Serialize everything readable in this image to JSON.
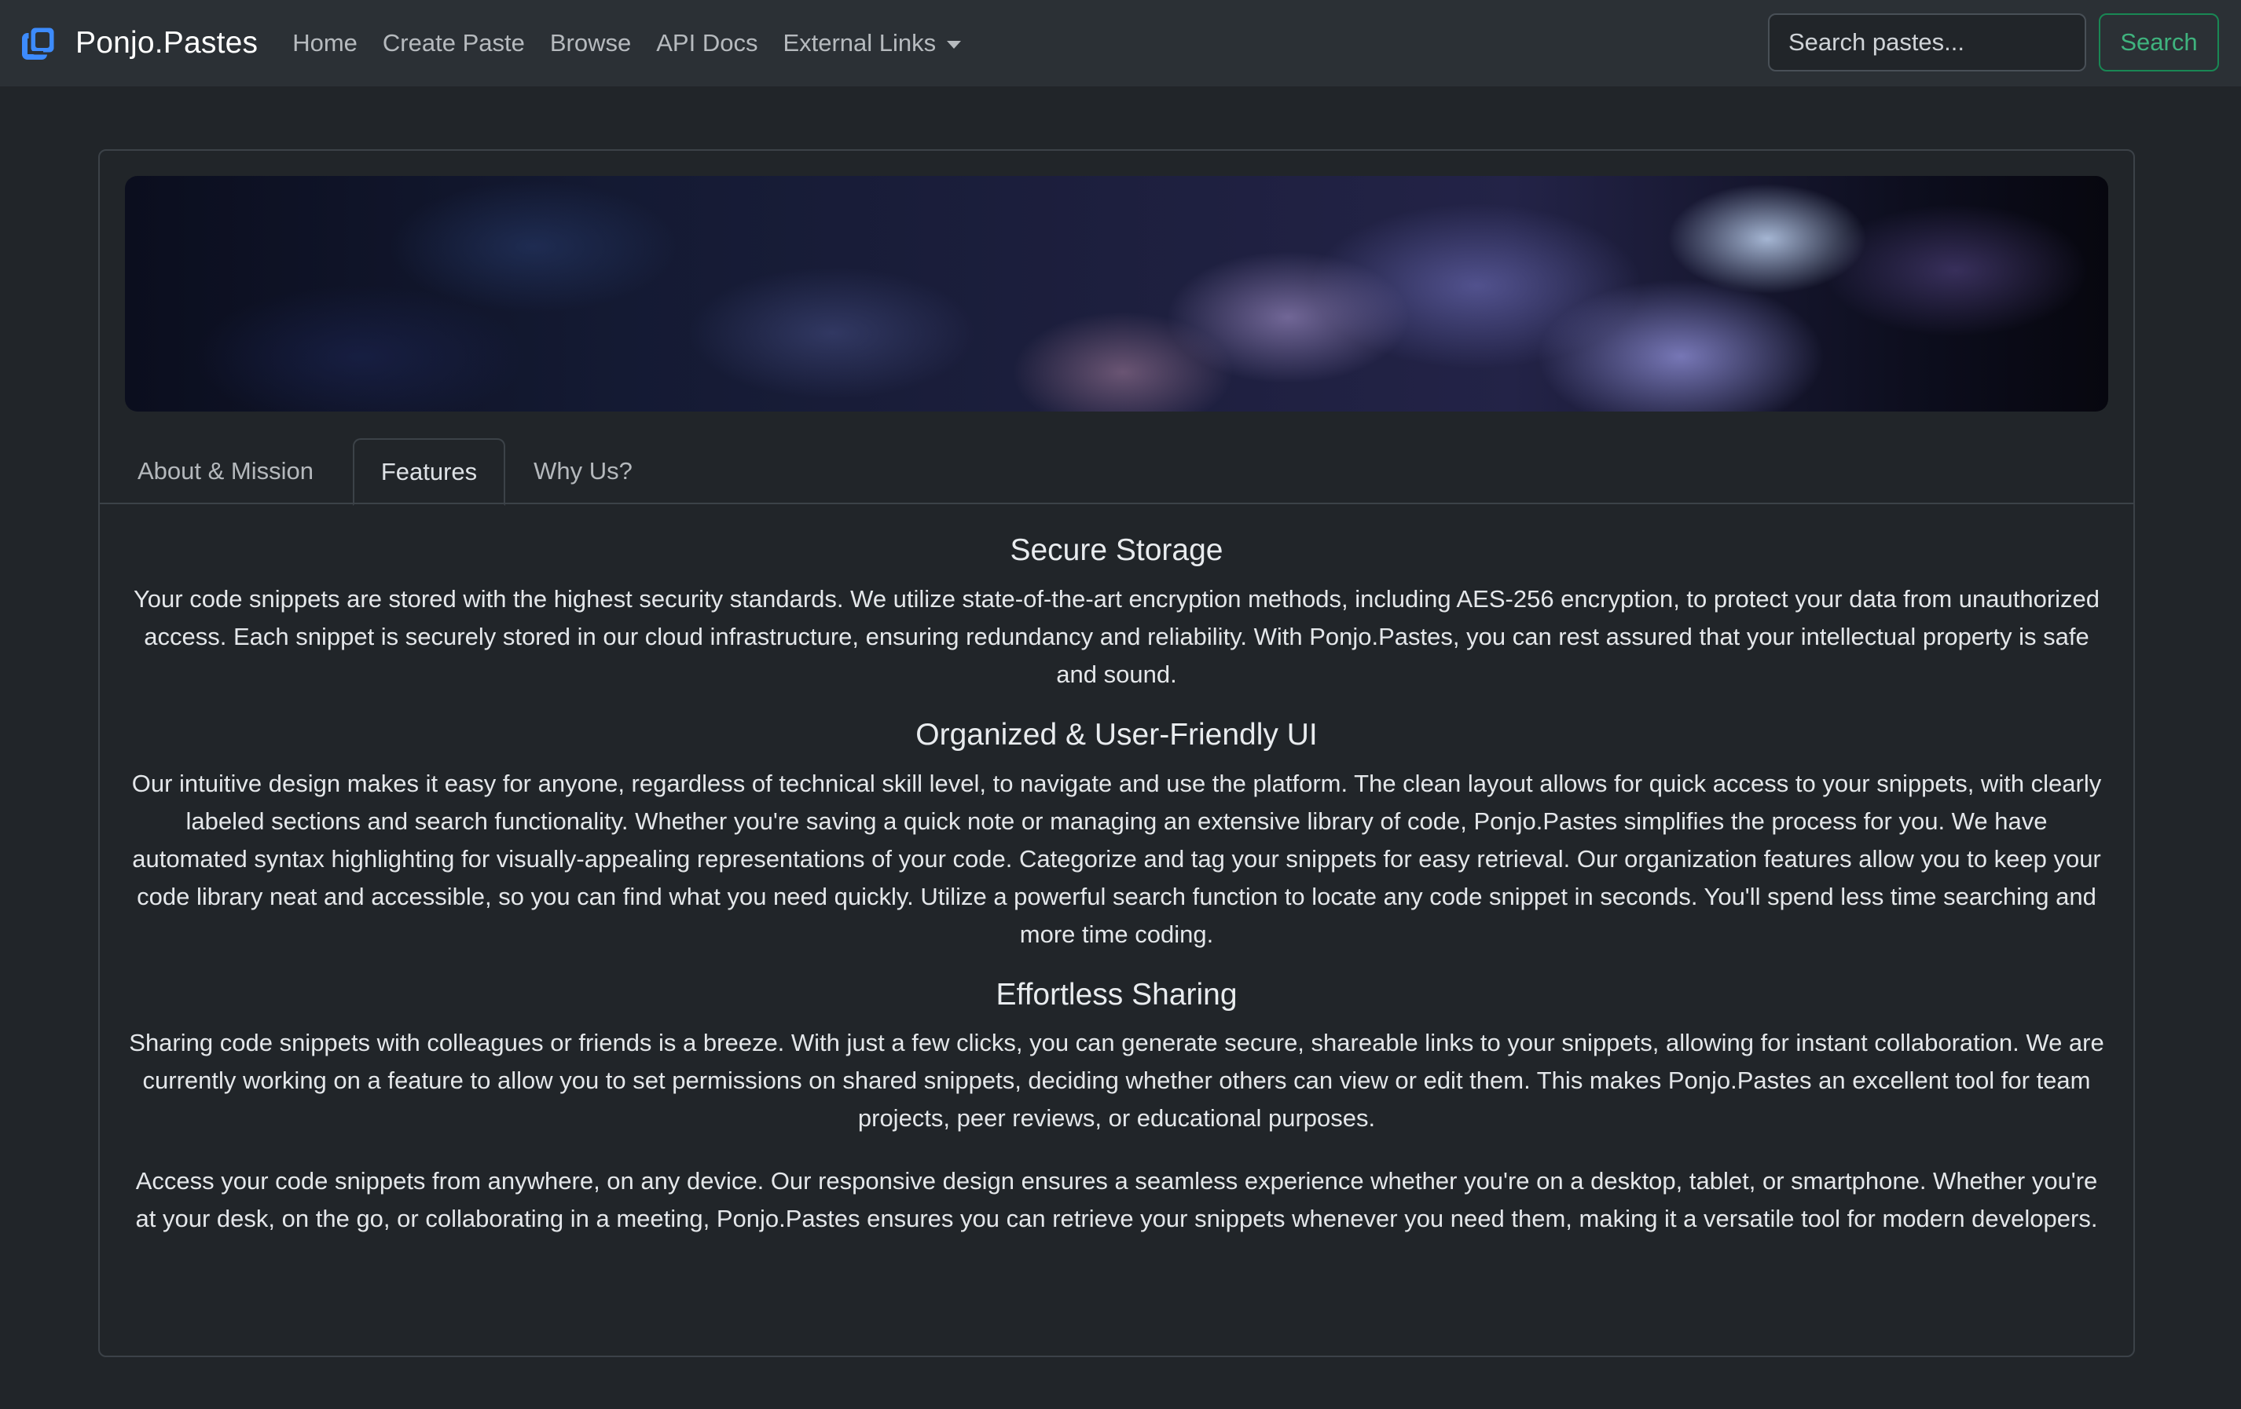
{
  "navbar": {
    "brand": "Ponjo.Pastes",
    "brand_icon": "paste-logo-icon",
    "links": [
      {
        "label": "Home"
      },
      {
        "label": "Create Paste"
      },
      {
        "label": "Browse"
      },
      {
        "label": "API Docs"
      },
      {
        "label": "External Links"
      }
    ],
    "dropdown_icon": "chevron-down-icon",
    "search": {
      "placeholder": "Search pastes...",
      "button_label": "Search"
    }
  },
  "tabs": [
    {
      "label": "About & Mission",
      "active": false
    },
    {
      "label": "Features",
      "active": true
    },
    {
      "label": "Why Us?",
      "active": false
    }
  ],
  "features": {
    "secure": {
      "title": "Secure Storage",
      "text": "Your code snippets are stored with the highest security standards. We utilize state-of-the-art encryption methods, including AES-256 encryption, to protect your data from unauthorized access. Each snippet is securely stored in our cloud infrastructure, ensuring redundancy and reliability. With Ponjo.Pastes, you can rest assured that your intellectual property is safe and sound."
    },
    "ui": {
      "title": "Organized & User-Friendly UI",
      "text": "Our intuitive design makes it easy for anyone, regardless of technical skill level, to navigate and use the platform. The clean layout allows for quick access to your snippets, with clearly labeled sections and search functionality. Whether you're saving a quick note or managing an extensive library of code, Ponjo.Pastes simplifies the process for you. We have automated syntax highlighting for visually-appealing representations of your code. Categorize and tag your snippets for easy retrieval. Our organization features allow you to keep your code library neat and accessible, so you can find what you need quickly. Utilize a powerful search function to locate any code snippet in seconds. You'll spend less time searching and more time coding."
    },
    "sharing": {
      "title": "Effortless Sharing",
      "text": "Sharing code snippets with colleagues or friends is a breeze. With just a few clicks, you can generate secure, shareable links to your snippets, allowing for instant collaboration. We are currently working on a feature to allow you to set permissions on shared snippets, deciding whether others can view or edit them. This makes Ponjo.Pastes an excellent tool for team projects, peer reviews, or educational purposes."
    },
    "access": {
      "text": "Access your code snippets from anywhere, on any device. Our responsive design ensures a seamless experience whether you're on a desktop, tablet, or smartphone. Whether you're at your desk, on the go, or collaborating in a meeting, Ponjo.Pastes ensures you can retrieve your snippets whenever you need them, making it a versatile tool for modern developers."
    }
  },
  "colors": {
    "page_bg": "#212529",
    "navbar_bg": "#2b3035",
    "brand_icon": "#3d8bfd",
    "search_button": "#198754"
  }
}
